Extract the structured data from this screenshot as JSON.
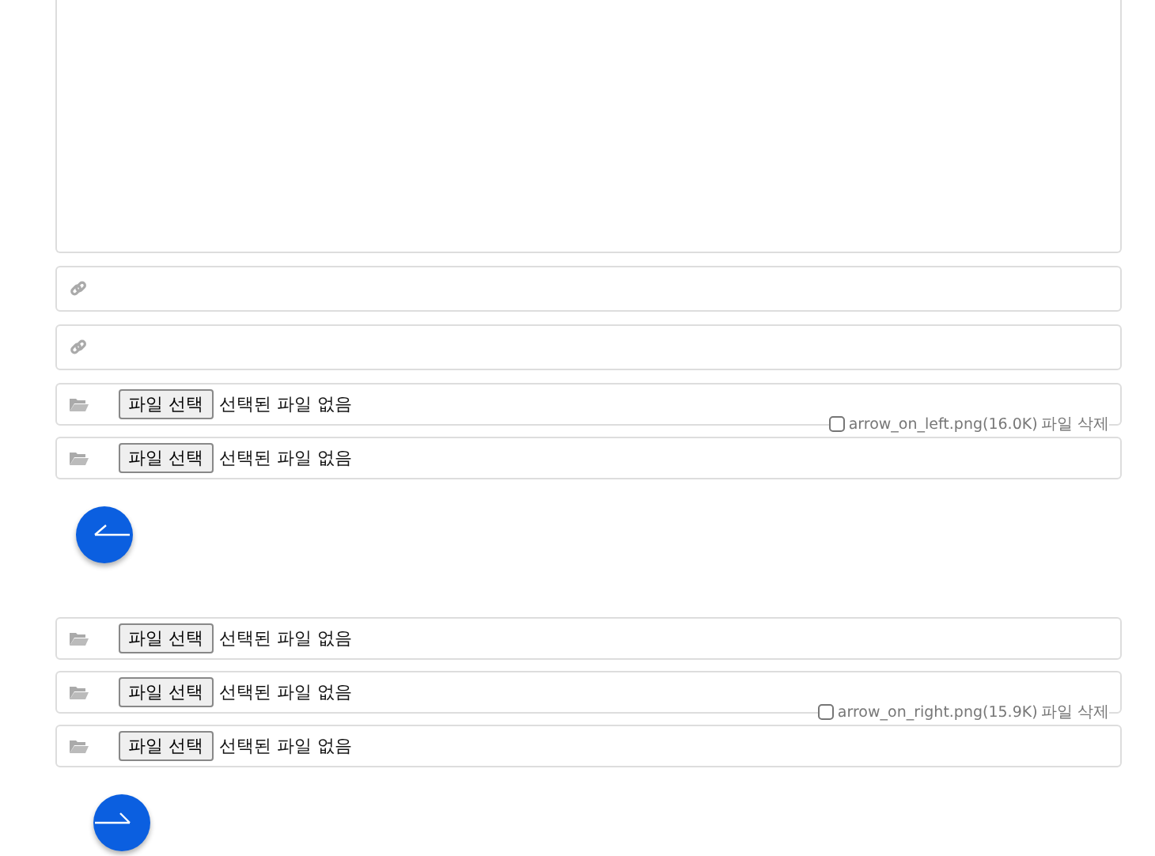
{
  "editor": {
    "kind": "textarea"
  },
  "link_fields": [
    {
      "kind": "link"
    },
    {
      "kind": "link"
    }
  ],
  "sections": [
    {
      "files": [
        {
          "button": "파일 선택",
          "status": "선택된 파일 없음",
          "delete": {
            "checked": false,
            "file": "arrow_on_left.png(16.0K)",
            "action": "파일 삭제"
          }
        },
        {
          "button": "파일 선택",
          "status": "선택된 파일 없음"
        }
      ],
      "preview": {
        "kind": "left"
      }
    },
    {
      "files": [
        {
          "button": "파일 선택",
          "status": "선택된 파일 없음"
        },
        {
          "button": "파일 선택",
          "status": "선택된 파일 없음",
          "delete": {
            "checked": false,
            "file": "arrow_on_right.png(15.9K)",
            "action": "파일 삭제"
          }
        },
        {
          "button": "파일 선택",
          "status": "선택된 파일 없음"
        }
      ],
      "preview": {
        "kind": "right"
      }
    }
  ]
}
